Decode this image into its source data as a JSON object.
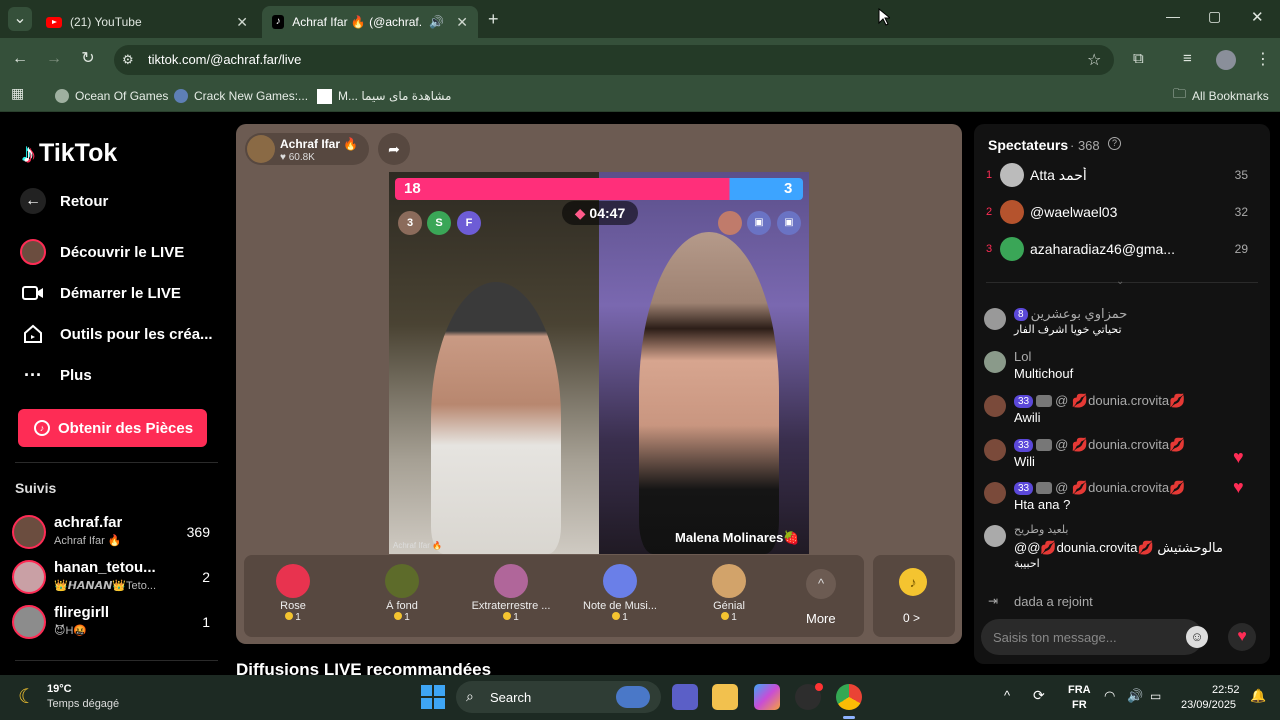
{
  "browser": {
    "tabs": [
      {
        "title": "(21) YouTube",
        "active": false
      },
      {
        "title": "Achraf Ifar 🔥 (@achraf.far)",
        "active": true
      }
    ],
    "new_tab": "+",
    "url": "tiktok.com/@achraf.far/live",
    "window": {
      "minimize": "—",
      "maximize": "▢",
      "close": "✕"
    },
    "bookmarks": [
      {
        "label": "Ocean Of Games"
      },
      {
        "label": "Crack New Games:..."
      },
      {
        "label": "M... مشاهدة ماى سيما"
      }
    ],
    "all_bookmarks": "All Bookmarks"
  },
  "sidebar": {
    "logo": "TikTok",
    "nav": [
      {
        "label": "Retour",
        "icon": "back-arrow-icon"
      },
      {
        "label": "Découvrir le LIVE",
        "icon": "live-avatar-icon"
      },
      {
        "label": "Démarrer le LIVE",
        "icon": "camera-icon"
      },
      {
        "label": "Outils pour les créa...",
        "icon": "house-icon"
      },
      {
        "label": "Plus",
        "icon": "more-dots-icon"
      }
    ],
    "coins_button": "Obtenir des Pièces",
    "following_title": "Suivis",
    "following": [
      {
        "name": "achraf.far",
        "sub": "Achraf Ifar 🔥",
        "count": "369"
      },
      {
        "name": "hanan_tetou...",
        "sub": "👑𝙃𝘼𝙉𝘼𝙉👑Teto...",
        "count": "2"
      },
      {
        "name": "fliregirll",
        "sub": "😈H🤬",
        "count": "1"
      }
    ]
  },
  "live": {
    "host_name": "Achraf Ifar 🔥",
    "host_likes": "♥ 60.8K",
    "score_left": "18",
    "score_right": "3",
    "timer": "04:47",
    "watermark": "Achraf Ifar 🔥",
    "opponent_name": "Malena Molinares🍓",
    "pips": [
      {
        "label": "3",
        "color": "#8b6b5b"
      },
      {
        "label": "S",
        "color": "#3aa657"
      },
      {
        "label": "F",
        "color": "#6d5cd6"
      }
    ],
    "gifts": [
      {
        "name": "Rose",
        "price": "1",
        "color": "#e8334f"
      },
      {
        "name": "À fond",
        "price": "1",
        "color": "#5d6b2a"
      },
      {
        "name": "Extraterrestre ...",
        "price": "1",
        "color": "#b0669a"
      },
      {
        "name": "Note de Musi...",
        "price": "1",
        "color": "#6a7fe8"
      },
      {
        "name": "Génial",
        "price": "1",
        "color": "#d2a36a"
      }
    ],
    "more_label": "More",
    "coin_balance": "0 >"
  },
  "recommended_title": "Diffusions LIVE recommandées",
  "chat": {
    "viewers_title": "Spectateurs",
    "viewers_count": "· 368",
    "top_viewers": [
      {
        "rank": "1",
        "name": "Atta أحمد",
        "score": "35",
        "color": "#bbb"
      },
      {
        "rank": "2",
        "name": "@waelwael03",
        "score": "32",
        "color": "#b5532d"
      },
      {
        "rank": "3",
        "name": "azaharadiaz46@gma...",
        "score": "29",
        "color": "#3aa657"
      }
    ],
    "messages": [
      {
        "user": "حمزاوي بوعشرين",
        "badge": "8",
        "text": "تحياتي خويا اشرف الفار",
        "heart": false
      },
      {
        "user": "Lol",
        "badge": "",
        "text": "Multichouf",
        "heart": false
      },
      {
        "user": "@ 💋dounia.crovita💋",
        "badge": "33",
        "text": "Awili",
        "heart": false
      },
      {
        "user": "@ 💋dounia.crovita💋",
        "badge": "33",
        "text": "Wili",
        "heart": true
      },
      {
        "user": "@ 💋dounia.crovita💋",
        "badge": "33",
        "text": "Hta ana ?",
        "heart": true
      },
      {
        "user": "بلعيد وطريح",
        "badge": "",
        "text": "@@💋dounia.crovita💋 مالوحشتيش",
        "heart": false
      }
    ],
    "message_extra": "احبيبة",
    "joined": "dada  a rejoint",
    "input_placeholder": "Saisis ton message..."
  },
  "taskbar": {
    "weather_temp": "19°C",
    "weather_desc": "Temps dégagé",
    "search": "Search",
    "lang_top": "FRA",
    "lang_bottom": "FR",
    "time": "22:52",
    "date": "23/09/2025"
  }
}
